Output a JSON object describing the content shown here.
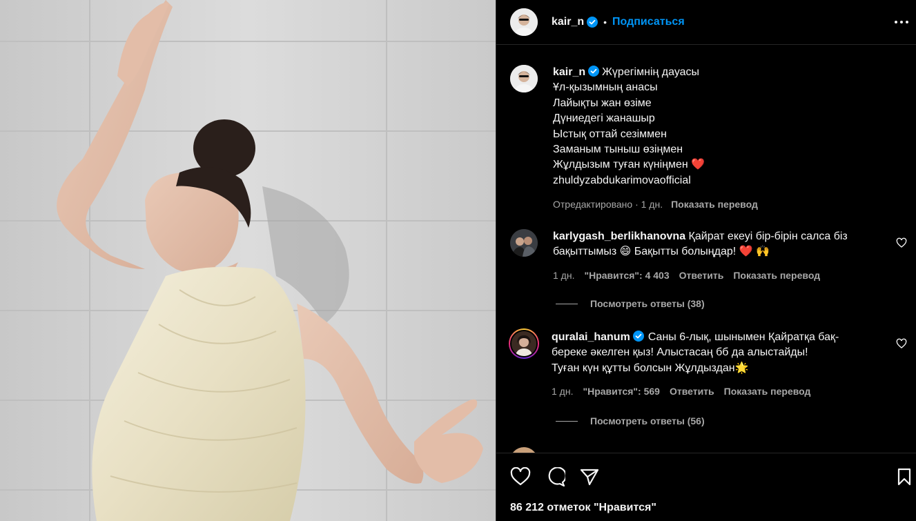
{
  "post": {
    "author": "kair_n",
    "follow_label": "Подписаться",
    "separator": "•",
    "photo_alt": "Woman in cream pleated halter dress posing against white wall"
  },
  "caption": {
    "username": "kair_n",
    "lines": [
      "Жүрегімнің дауасы",
      "Ұл-қызымның анасы",
      "Лайықты жан өзіме",
      "Дүниедегі жанашыр",
      "Ыстық оттай сезіммен",
      "Заманым тыныш өзіңмен",
      "Жұлдызым туған күніңмен ❤️",
      "zhuldyzabdukarimovaofficial"
    ],
    "edited": "Отредактировано · 1 дн.",
    "translate": "Показать перевод"
  },
  "comments": [
    {
      "username": "karlygash_berlikhanovna",
      "text_lines": [
        "Қайрат екеуі бір-бірін салса біз",
        "бақыттымыз 😄 Бақытты болыңдар! ❤️ 🙌"
      ],
      "time": "1 дн.",
      "likes": "\"Нравится\": 4 403",
      "reply": "Ответить",
      "translate": "Показать перевод",
      "view_replies": "Посмотреть ответы (38)"
    },
    {
      "username": "quralai_hanum",
      "text_lines": [
        "Саны 6-лық, шынымен Қайратқа бақ-",
        "береке әкелген қыз! Алыстасаң бб да алыстайды!",
        "Туған күн құтты болсын Жұлдыздан🌟"
      ],
      "time": "1 дн.",
      "likes": "\"Нравится\": 569",
      "reply": "Ответить",
      "translate": "Показать перевод",
      "view_replies": "Посмотреть ответы (56)"
    }
  ],
  "footer": {
    "likes_count": "86 212 отметок \"Нравится\""
  },
  "colors": {
    "accent": "#0095f6",
    "secondary_text": "#a8a8a8",
    "verified": "#0095f6",
    "heart_red": "#ff3040"
  }
}
